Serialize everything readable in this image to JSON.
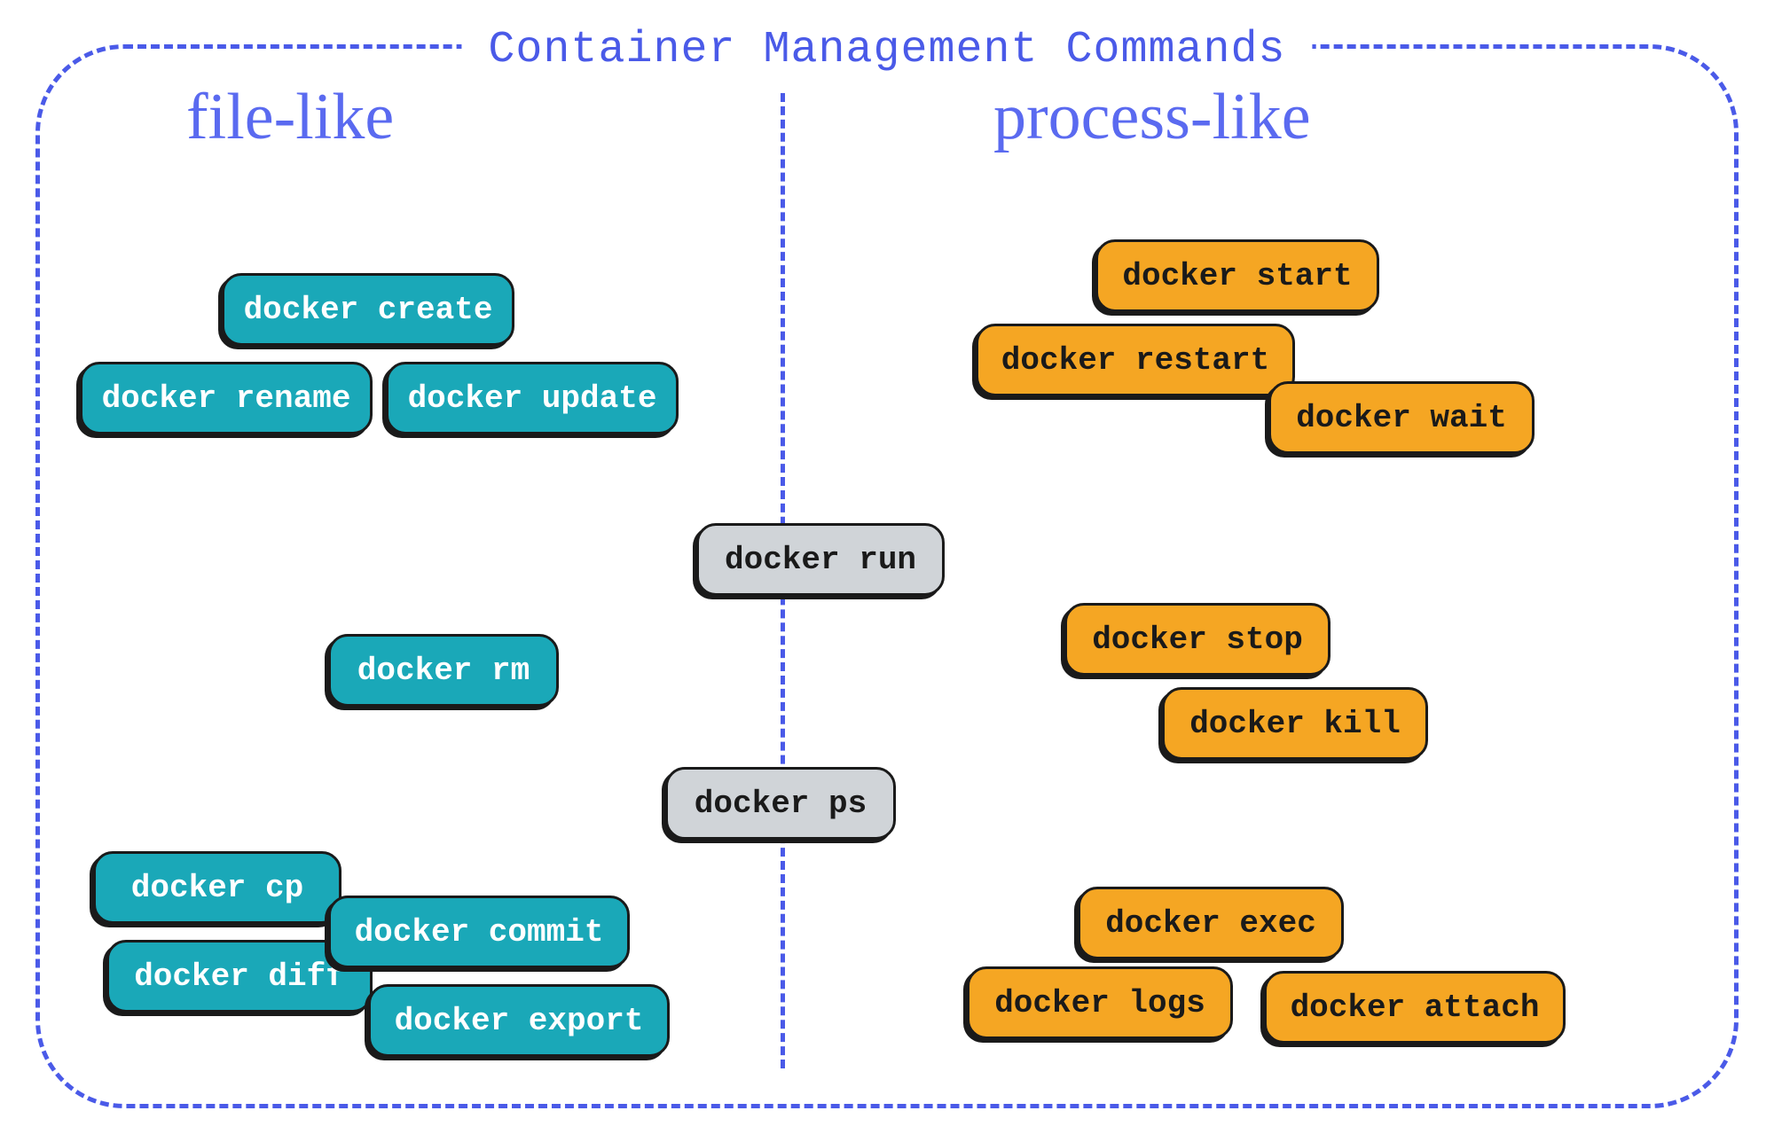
{
  "title": "Container Management Commands",
  "groups": {
    "file_like": {
      "label": "file-like",
      "commands": {
        "create": "docker create",
        "rename": "docker rename",
        "update": "docker update",
        "rm": "docker rm",
        "cp": "docker cp",
        "diff": "docker diff",
        "commit": "docker commit",
        "export": "docker export"
      }
    },
    "process_like": {
      "label": "process-like",
      "commands": {
        "start": "docker start",
        "restart": "docker restart",
        "wait": "docker wait",
        "stop": "docker stop",
        "kill": "docker kill",
        "exec": "docker exec",
        "logs": "docker logs",
        "attach": "docker attach"
      }
    },
    "shared": {
      "commands": {
        "run": "docker run",
        "ps": "docker ps"
      }
    }
  },
  "colors": {
    "teal": "#1aa8b8",
    "orange": "#f5a623",
    "gray": "#d0d4d8",
    "border": "#4a5ae8"
  }
}
